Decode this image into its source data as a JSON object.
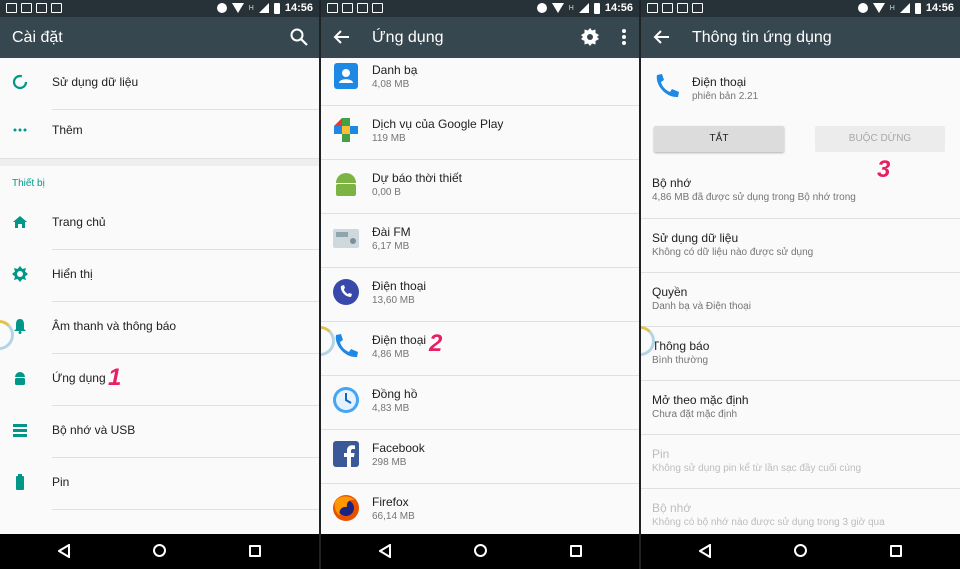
{
  "status_bar": {
    "time": "14:56",
    "network": "H"
  },
  "colors": {
    "accent": "#009688",
    "toolbar": "#37474f",
    "statusbar": "#263238",
    "marker": "#e91e63"
  },
  "panel1": {
    "title": "Cài đặt",
    "items_top": [
      {
        "label": "Sử dụng dữ liệu",
        "icon": "data-usage-icon"
      },
      {
        "label": "Thêm",
        "icon": "more-dots-icon"
      }
    ],
    "section": "Thiết bị",
    "items": [
      {
        "label": "Trang chủ",
        "icon": "home-icon"
      },
      {
        "label": "Hiển thị",
        "icon": "brightness-icon"
      },
      {
        "label": "Âm thanh và thông báo",
        "icon": "bell-icon"
      },
      {
        "label": "Ứng dụng",
        "icon": "android-icon"
      },
      {
        "label": "Bộ nhớ và USB",
        "icon": "storage-icon"
      },
      {
        "label": "Pin",
        "icon": "battery-icon"
      }
    ],
    "marker": "1"
  },
  "panel2": {
    "title": "Ứng dụng",
    "apps": [
      {
        "name": "Danh bạ",
        "size": "4,08 MB",
        "icon": "contacts-icon"
      },
      {
        "name": "Dịch vụ của Google Play",
        "size": "119 MB",
        "icon": "play-services-icon"
      },
      {
        "name": "Dự báo thời thiết",
        "size": "0,00 B",
        "icon": "android-app-icon"
      },
      {
        "name": "Đài FM",
        "size": "6,17 MB",
        "icon": "radio-icon"
      },
      {
        "name": "Điện thoại",
        "size": "13,60 MB",
        "icon": "phone-circle-icon"
      },
      {
        "name": "Điện thoại",
        "size": "4,86 MB",
        "icon": "phone-icon"
      },
      {
        "name": "Đồng hồ",
        "size": "4,83 MB",
        "icon": "clock-icon"
      },
      {
        "name": "Facebook",
        "size": "298 MB",
        "icon": "facebook-icon"
      },
      {
        "name": "Firefox",
        "size": "66,14 MB",
        "icon": "firefox-icon"
      }
    ],
    "marker": "2"
  },
  "panel3": {
    "title": "Thông tin ứng dụng",
    "app_name": "Điện thoại",
    "app_version": "phiên bản 2.21",
    "btn_disable": "TẮT",
    "btn_force_stop": "BUỘC DỪNG",
    "marker": "3",
    "rows": [
      {
        "title": "Bộ nhớ",
        "sub": "4,86 MB đã được sử dụng trong Bộ nhớ trong",
        "dim": false
      },
      {
        "title": "Sử dụng dữ liệu",
        "sub": "Không có dữ liệu nào được sử dụng",
        "dim": false
      },
      {
        "title": "Quyền",
        "sub": "Danh bạ và Điện thoại",
        "dim": false
      },
      {
        "title": "Thông báo",
        "sub": "Bình thường",
        "dim": false
      },
      {
        "title": "Mở theo mặc định",
        "sub": "Chưa đặt mặc định",
        "dim": false
      },
      {
        "title": "Pin",
        "sub": "Không sử dụng pin kể từ lần sạc đầy cuối cùng",
        "dim": true
      },
      {
        "title": "Bộ nhớ",
        "sub": "Không có bộ nhớ nào được sử dụng trong 3 giờ qua",
        "dim": true
      }
    ]
  }
}
